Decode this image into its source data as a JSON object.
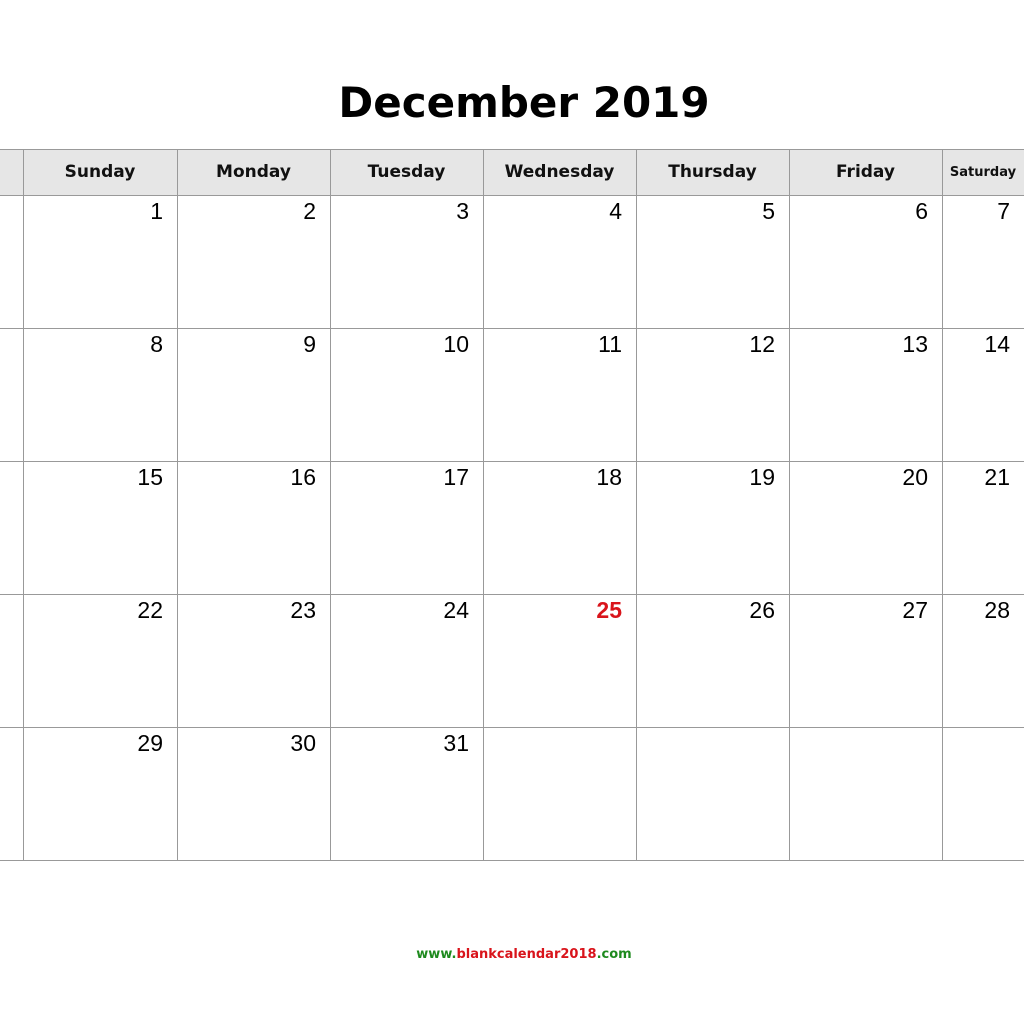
{
  "title": "December 2019",
  "weekdays": [
    "",
    "Sunday",
    "Monday",
    "Tuesday",
    "Wednesday",
    "Thursday",
    "Friday",
    "Saturday"
  ],
  "weeks": [
    [
      "",
      "1",
      "2",
      "3",
      "4",
      "5",
      "6",
      "7"
    ],
    [
      "",
      "8",
      "9",
      "10",
      "11",
      "12",
      "13",
      "14"
    ],
    [
      "",
      "15",
      "16",
      "17",
      "18",
      "19",
      "20",
      "21"
    ],
    [
      "",
      "22",
      "23",
      "24",
      "25",
      "26",
      "27",
      "28"
    ],
    [
      "",
      "29",
      "30",
      "31",
      "",
      "",
      "",
      ""
    ]
  ],
  "holidays": [
    "25"
  ],
  "holiday_color": "#d9141b",
  "footer": {
    "prefix": "www.",
    "name": "blankcalendar2018",
    "suffix": ".com"
  },
  "footer_colors": {
    "green": "#1e8a1e",
    "red": "#d9141b"
  }
}
